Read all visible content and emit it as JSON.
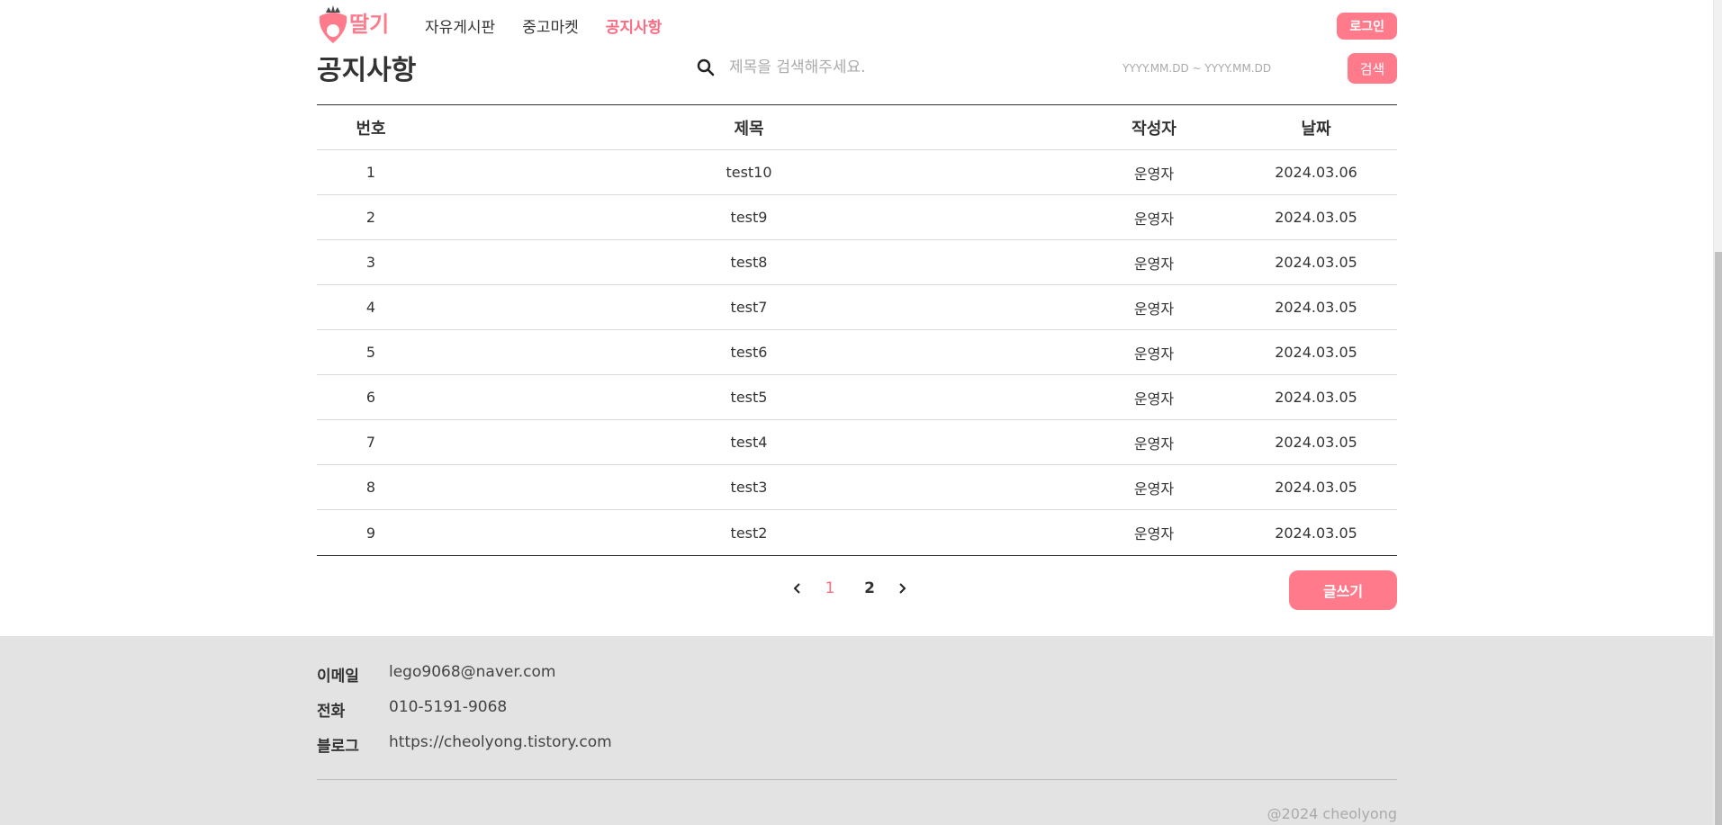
{
  "header": {
    "logo_text": "딸기",
    "nav": [
      "자유게시판",
      "중고마켓",
      "공지사항"
    ],
    "login_label": "로그인"
  },
  "page_title": "공지사항",
  "search": {
    "placeholder": "제목을 검색해주세요.",
    "date_placeholder": "YYYY.MM.DD ~ YYYY.MM.DD",
    "button_label": "검색"
  },
  "table": {
    "headers": [
      "번호",
      "제목",
      "작성자",
      "날짜"
    ],
    "rows": [
      {
        "no": "1",
        "title": "test10",
        "author": "운영자",
        "date": "2024.03.06"
      },
      {
        "no": "2",
        "title": "test9",
        "author": "운영자",
        "date": "2024.03.05"
      },
      {
        "no": "3",
        "title": "test8",
        "author": "운영자",
        "date": "2024.03.05"
      },
      {
        "no": "4",
        "title": "test7",
        "author": "운영자",
        "date": "2024.03.05"
      },
      {
        "no": "5",
        "title": "test6",
        "author": "운영자",
        "date": "2024.03.05"
      },
      {
        "no": "6",
        "title": "test5",
        "author": "운영자",
        "date": "2024.03.05"
      },
      {
        "no": "7",
        "title": "test4",
        "author": "운영자",
        "date": "2024.03.05"
      },
      {
        "no": "8",
        "title": "test3",
        "author": "운영자",
        "date": "2024.03.05"
      },
      {
        "no": "9",
        "title": "test2",
        "author": "운영자",
        "date": "2024.03.05"
      }
    ]
  },
  "pagination": {
    "pages": [
      "1",
      "2"
    ],
    "current": "1"
  },
  "write_label": "글쓰기",
  "footer": {
    "email_label": "이메일",
    "email": "lego9068@naver.com",
    "phone_label": "전화",
    "phone": "010-5191-9068",
    "blog_label": "블로그",
    "blog": "https://cheolyong.tistory.com",
    "copyright": "@2024 cheolyong"
  },
  "colors": {
    "accent": "#ff7b8c",
    "footer_bg": "#e3e3e3"
  }
}
